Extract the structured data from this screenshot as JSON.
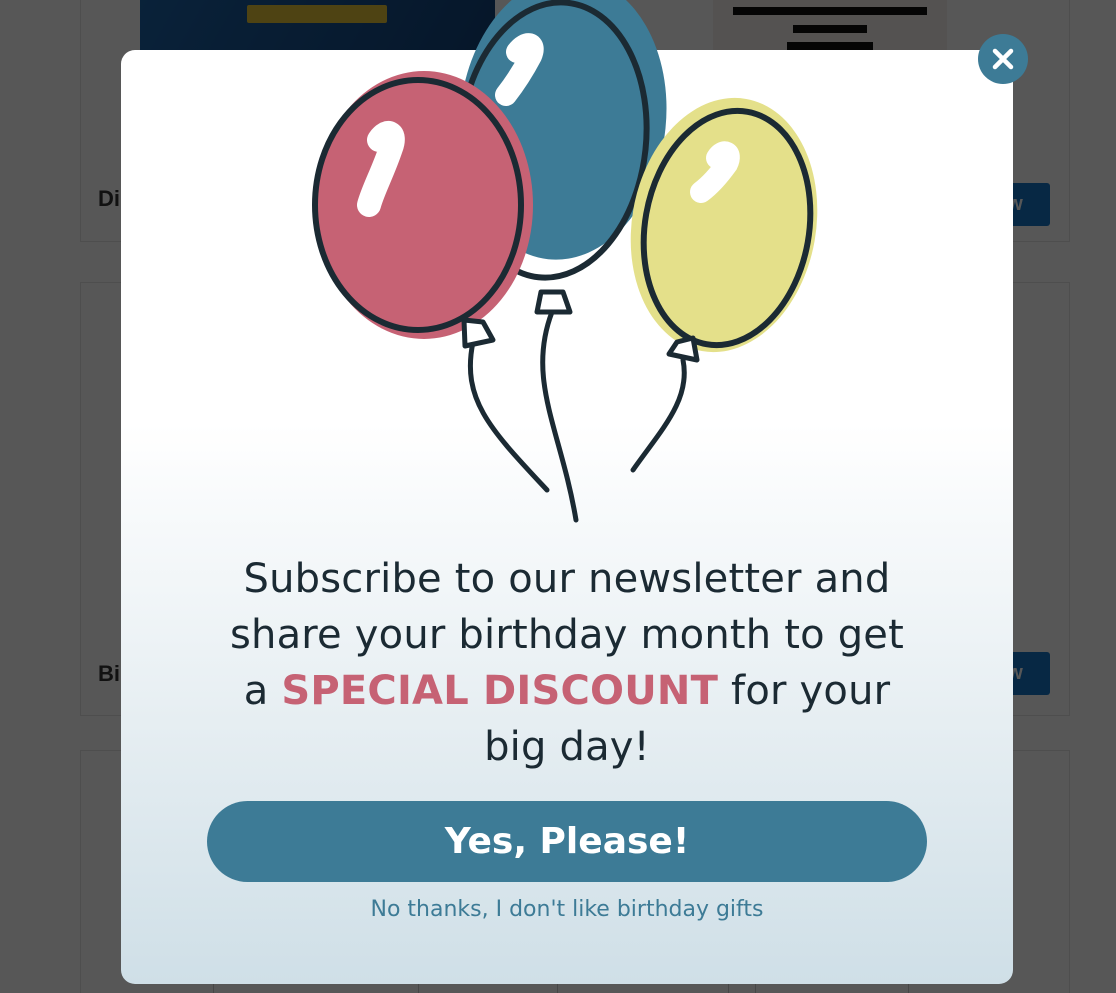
{
  "background_page": {
    "card_titles": [
      "Di",
      "Bi"
    ],
    "card_button_labels": [
      "w",
      "w"
    ]
  },
  "popup": {
    "close_icon": "close-icon",
    "illustration": "balloons-illustration",
    "headline": {
      "line1": "Subscribe to our newsletter and",
      "line2": "share your birthday month to get",
      "line3_prefix": "a",
      "line3_highlight": "SPECIAL DISCOUNT",
      "line3_suffix": "for your",
      "line4": "big day!"
    },
    "primary_button": "Yes, Please!",
    "decline_link": "No thanks, I don't like birthday gifts"
  },
  "colors": {
    "accent": "#3d7b96",
    "highlight": "#c66274",
    "text_dark": "#1b2a33",
    "balloon_red": "#c66274",
    "balloon_blue": "#3d7b96",
    "balloon_yellow": "#e4e08a"
  }
}
